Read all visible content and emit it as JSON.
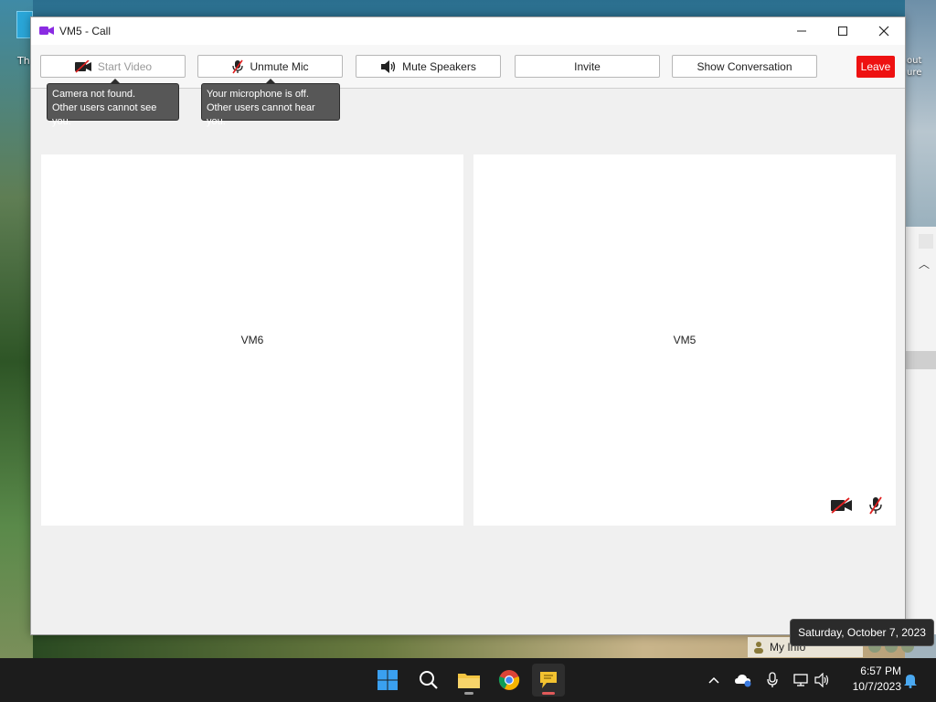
{
  "window": {
    "title": "VM5 - Call",
    "controls": {
      "minimize": "—",
      "maximize": "☐",
      "close": "✕"
    }
  },
  "toolbar": {
    "start_video": "Start Video",
    "unmute_mic": "Unmute Mic",
    "mute_speakers": "Mute Speakers",
    "invite": "Invite",
    "show_conversation": "Show Conversation",
    "leave": "Leave"
  },
  "tooltips": {
    "video": {
      "line1": "Camera not found.",
      "line2": "Other users cannot see you."
    },
    "mic": {
      "line1": "Your microphone is off.",
      "line2": "Other users cannot hear you."
    }
  },
  "participants": [
    {
      "name": "VM6"
    },
    {
      "name": "VM5"
    }
  ],
  "desktop": {
    "left_label": "Th",
    "right_label_1": "out",
    "right_label_2": "ure",
    "my_info": "My Info"
  },
  "taskbar": {
    "time": "6:57 PM",
    "date": "10/7/2023",
    "date_tooltip": "Saturday, October 7, 2023"
  },
  "colors": {
    "leave_button": "#ee1111",
    "tooltip_bg": "#575757",
    "tile_bg": "#ffffff",
    "window_bg": "#f0f0f0",
    "taskbar_bg": "#1c1c1c"
  },
  "icons": {
    "title": "video-camera-icon",
    "video_button": "camera-off-icon",
    "mic_button": "mic-off-icon",
    "speakers_button": "speaker-icon",
    "tile_status": [
      "camera-off-icon",
      "mic-off-icon"
    ]
  }
}
